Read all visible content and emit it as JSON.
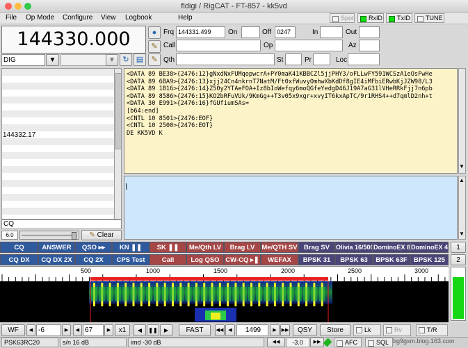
{
  "window": {
    "title": "fldigi / RigCAT - FT-857 - kk5vd"
  },
  "menu": [
    "File",
    "Op Mode",
    "Configure",
    "View",
    "Logbook",
    "Help"
  ],
  "indicators": {
    "spot": "Spot",
    "rxid": "RxID",
    "txid": "TxID",
    "tune": "TUNE"
  },
  "frequency": {
    "display": "144330.000"
  },
  "log": {
    "frq_label": "Frq",
    "frq_value": "144331.499",
    "on_label": "On",
    "on_value": "",
    "off_label": "Off",
    "off_value": "0247",
    "in_label": "In",
    "out_label": "Out",
    "call_label": "Call",
    "op_label": "Op",
    "az_label": "Az",
    "qth_label": "Qth",
    "st_label": "St",
    "pr_label": "Pr",
    "loc_label": "Loc"
  },
  "mode_select": {
    "value": "DIG"
  },
  "freq_list": {
    "entry": "144332.17"
  },
  "rx_text": [
    "<DATA 89 BE38>{2476:12}gNxdNxFUMqopwcrA+PY0maK41KBBCZl5jjPHY3/oFLLwFY591WCSzA1eOsFwHe",
    "<DATA 89 6BA9>{2476:13}xjj24Cn4nkrnT7NatM/Ft0xfWuvyOmhwXbKdDf8gIE4iMFbiERwbKjJZW98/L3",
    "<DATA 89 1B16>{2476:14}Z50y2YTAeFOA+Iz8bIoWefqy6moQGfeYedgD46J19A7aG31lVHeRRkFjj7n6pb",
    "<DATA 89 8586>{2476:15}KO2bRFuVUk/9KmGg++T3v05x9xgr+xvyIT6kxApTC/9r1RHS4++d7qmlD2nh+t",
    "<DATA 30 E991>{2476:16}fGUfiumSAs=",
    "[b64:end]",
    "<CNTL 10 8501>{2476:EOF}",
    "<CNTL 10 2500>{2476:EOT}",
    "",
    "DE KK5VD K"
  ],
  "left_tools": {
    "call_field": "CQ",
    "squelch_value": "6.0",
    "clear_label": "Clear"
  },
  "macros_row1": [
    "CQ",
    "ANSWER",
    "QSO ▸▸",
    "KN ❚❚",
    "SK ❚❚",
    "Me/Qth LV",
    "Brag LV",
    "Me/QTH SV",
    "Brag SV",
    "Olivia 16/500",
    "DominoEX 8",
    "DominoEX 4"
  ],
  "macros_row2": [
    "CQ DX",
    "CQ DX 2X",
    "CQ 2X",
    "CPS Test",
    "Call",
    "Log QSO",
    "CW-CQ ▸❚",
    "WEFAX",
    "BPSK 31",
    "BPSK 63",
    "BPSK 63F",
    "BPSK 125"
  ],
  "macro_set": {
    "row1": "1",
    "row2": "2"
  },
  "scale": [
    "500",
    "1000",
    "1500",
    "2000",
    "2500",
    "3000"
  ],
  "wf_controls": {
    "wf_label": "WF",
    "ref_level": "-6",
    "range": "67",
    "zoom": "x1",
    "speed": "FAST",
    "carrier": "1499",
    "qsy": "QSY",
    "store": "Store",
    "lk": "Lk",
    "rv": "Rv",
    "tr": "T/R"
  },
  "status": {
    "mode": "PSK63RC20",
    "sn": "s/n 16 dB",
    "imd": "imd -30 dB",
    "offset": "-3.0",
    "afc": "AFC",
    "sql": "SQL",
    "watermark": "bg9gxm.blog.163.com"
  },
  "colors": {
    "rx_bg": "#fdf3c8",
    "tx_bg": "#cfe7fc",
    "macro_blue": "#2f5a9e",
    "macro_red": "#a64747",
    "macro_purple": "#4a4678"
  }
}
